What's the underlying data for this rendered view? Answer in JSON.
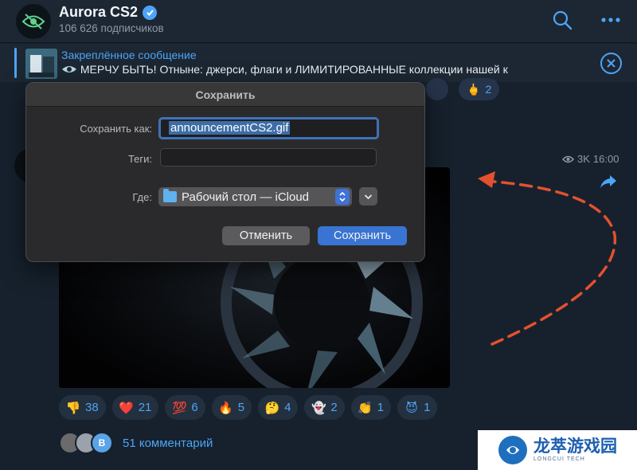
{
  "header": {
    "channel_name": "Aurora CS2",
    "subscribers": "106 626 подписчиков"
  },
  "pinned": {
    "title": "Закреплённое сообщение",
    "text": "МЕРЧУ БЫТЬ! Отныне: джерси, флаги и ЛИМИТИРОВАННЫЕ коллекции нашей к"
  },
  "top_reaction": {
    "count": "2"
  },
  "post": {
    "views": "3K",
    "time": "16:00"
  },
  "reactions": [
    {
      "emoji": "👎",
      "count": "38"
    },
    {
      "emoji": "❤️",
      "count": "21"
    },
    {
      "emoji": "💯",
      "count": "6"
    },
    {
      "emoji": "🔥",
      "count": "5"
    },
    {
      "emoji": "🤔",
      "count": "4"
    },
    {
      "emoji": "👻",
      "count": "2"
    },
    {
      "emoji": "👏",
      "count": "1"
    },
    {
      "emoji": "😈",
      "count": "1"
    }
  ],
  "comments": {
    "avatar_letter": "B",
    "label": "51 комментарий"
  },
  "dialog": {
    "title": "Сохранить",
    "save_as_label": "Сохранить как:",
    "filename": "announcementCS2.gif",
    "tags_label": "Теги:",
    "tags_value": "",
    "where_label": "Где:",
    "where_value": "Рабочий стол — iCloud",
    "cancel_label": "Отменить",
    "save_label": "Сохранить"
  },
  "watermark": {
    "text": "龙萃游戏园",
    "sub": "LONGCUI TECH"
  },
  "colors": {
    "accent": "#4ea4f6",
    "background": "#16212d",
    "arrow": "#e4502e",
    "dialog_primary": "#3a74d3"
  }
}
